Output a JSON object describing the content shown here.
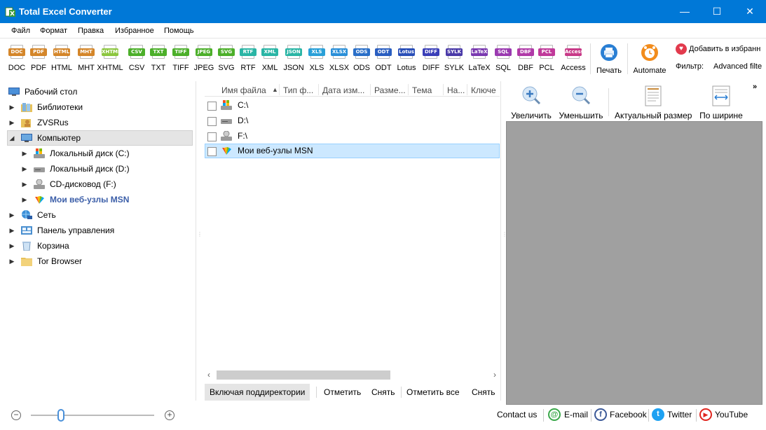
{
  "window": {
    "title": "Total Excel Converter",
    "minimize": "—",
    "maximize": "☐",
    "close": "✕"
  },
  "menu": [
    "Файл",
    "Формат",
    "Правка",
    "Избранное",
    "Помощь"
  ],
  "formats": [
    {
      "label": "DOC",
      "color": "#d4862a"
    },
    {
      "label": "PDF",
      "color": "#d4862a"
    },
    {
      "label": "HTML",
      "color": "#d4862a"
    },
    {
      "label": "MHT",
      "color": "#d4862a"
    },
    {
      "label": "XHTML",
      "color": "#8cc63f"
    },
    {
      "label": "CSV",
      "color": "#4caf2a"
    },
    {
      "label": "TXT",
      "color": "#4caf2a"
    },
    {
      "label": "TIFF",
      "color": "#4caf2a"
    },
    {
      "label": "JPEG",
      "color": "#4caf2a"
    },
    {
      "label": "SVG",
      "color": "#4caf2a"
    },
    {
      "label": "RTF",
      "color": "#2ab5a5"
    },
    {
      "label": "XML",
      "color": "#2ab5a5"
    },
    {
      "label": "JSON",
      "color": "#2ab5a5"
    },
    {
      "label": "XLS",
      "color": "#2aa0d8"
    },
    {
      "label": "XLSX",
      "color": "#2a8fd8"
    },
    {
      "label": "ODS",
      "color": "#2a6fc8"
    },
    {
      "label": "ODT",
      "color": "#2a5ec0"
    },
    {
      "label": "Lotus",
      "color": "#2a4fb8"
    },
    {
      "label": "DIFF",
      "color": "#3a3fb8"
    },
    {
      "label": "SYLK",
      "color": "#4a3aa8"
    },
    {
      "label": "LaTeX",
      "color": "#7a3ab0"
    },
    {
      "label": "SQL",
      "color": "#9a3ab0"
    },
    {
      "label": "DBF",
      "color": "#b03aa8"
    },
    {
      "label": "PCL",
      "color": "#c03a9a"
    },
    {
      "label": "Access",
      "color": "#c83a88"
    }
  ],
  "toolbar": {
    "print": "Печать",
    "automate": "Automate",
    "favorites": "Добавить в избранн",
    "filter_label": "Фильтр:",
    "filter_value": "Advanced filte"
  },
  "tree": {
    "desktop": "Рабочий стол",
    "libraries": "Библиотеки",
    "zvsrus": "ZVSRus",
    "computer": "Компьютер",
    "disk_c": "Локальный диск (C:)",
    "disk_d": "Локальный диск (D:)",
    "cd": "CD-дисковод (F:)",
    "msn": "Мои веб-узлы MSN",
    "network": "Сеть",
    "control_panel": "Панель управления",
    "recycle": "Корзина",
    "tor": "Tor Browser"
  },
  "filelist": {
    "columns": [
      "Имя файла",
      "Тип ф...",
      "Дата изм...",
      "Разме...",
      "Тема",
      "На...",
      "Ключе"
    ],
    "rows": [
      "C:\\",
      "D:\\",
      "F:\\",
      "Мои веб-узлы MSN"
    ]
  },
  "actions": {
    "include_subdirs": "Включая поддиректории",
    "mark": "Отметить",
    "unmark": "Снять",
    "mark_all": "Отметить все",
    "unmark_all": "Снять"
  },
  "preview": {
    "zoom_in": "Увеличить",
    "zoom_out": "Уменьшить",
    "actual_size": "Актуальный размер",
    "fit_width": "По ширине",
    "more": "»"
  },
  "status": {
    "contact": "Contact us",
    "email": "E-mail",
    "facebook": "Facebook",
    "twitter": "Twitter",
    "youtube": "YouTube",
    "zoom_minus": "−",
    "zoom_plus": "+"
  }
}
